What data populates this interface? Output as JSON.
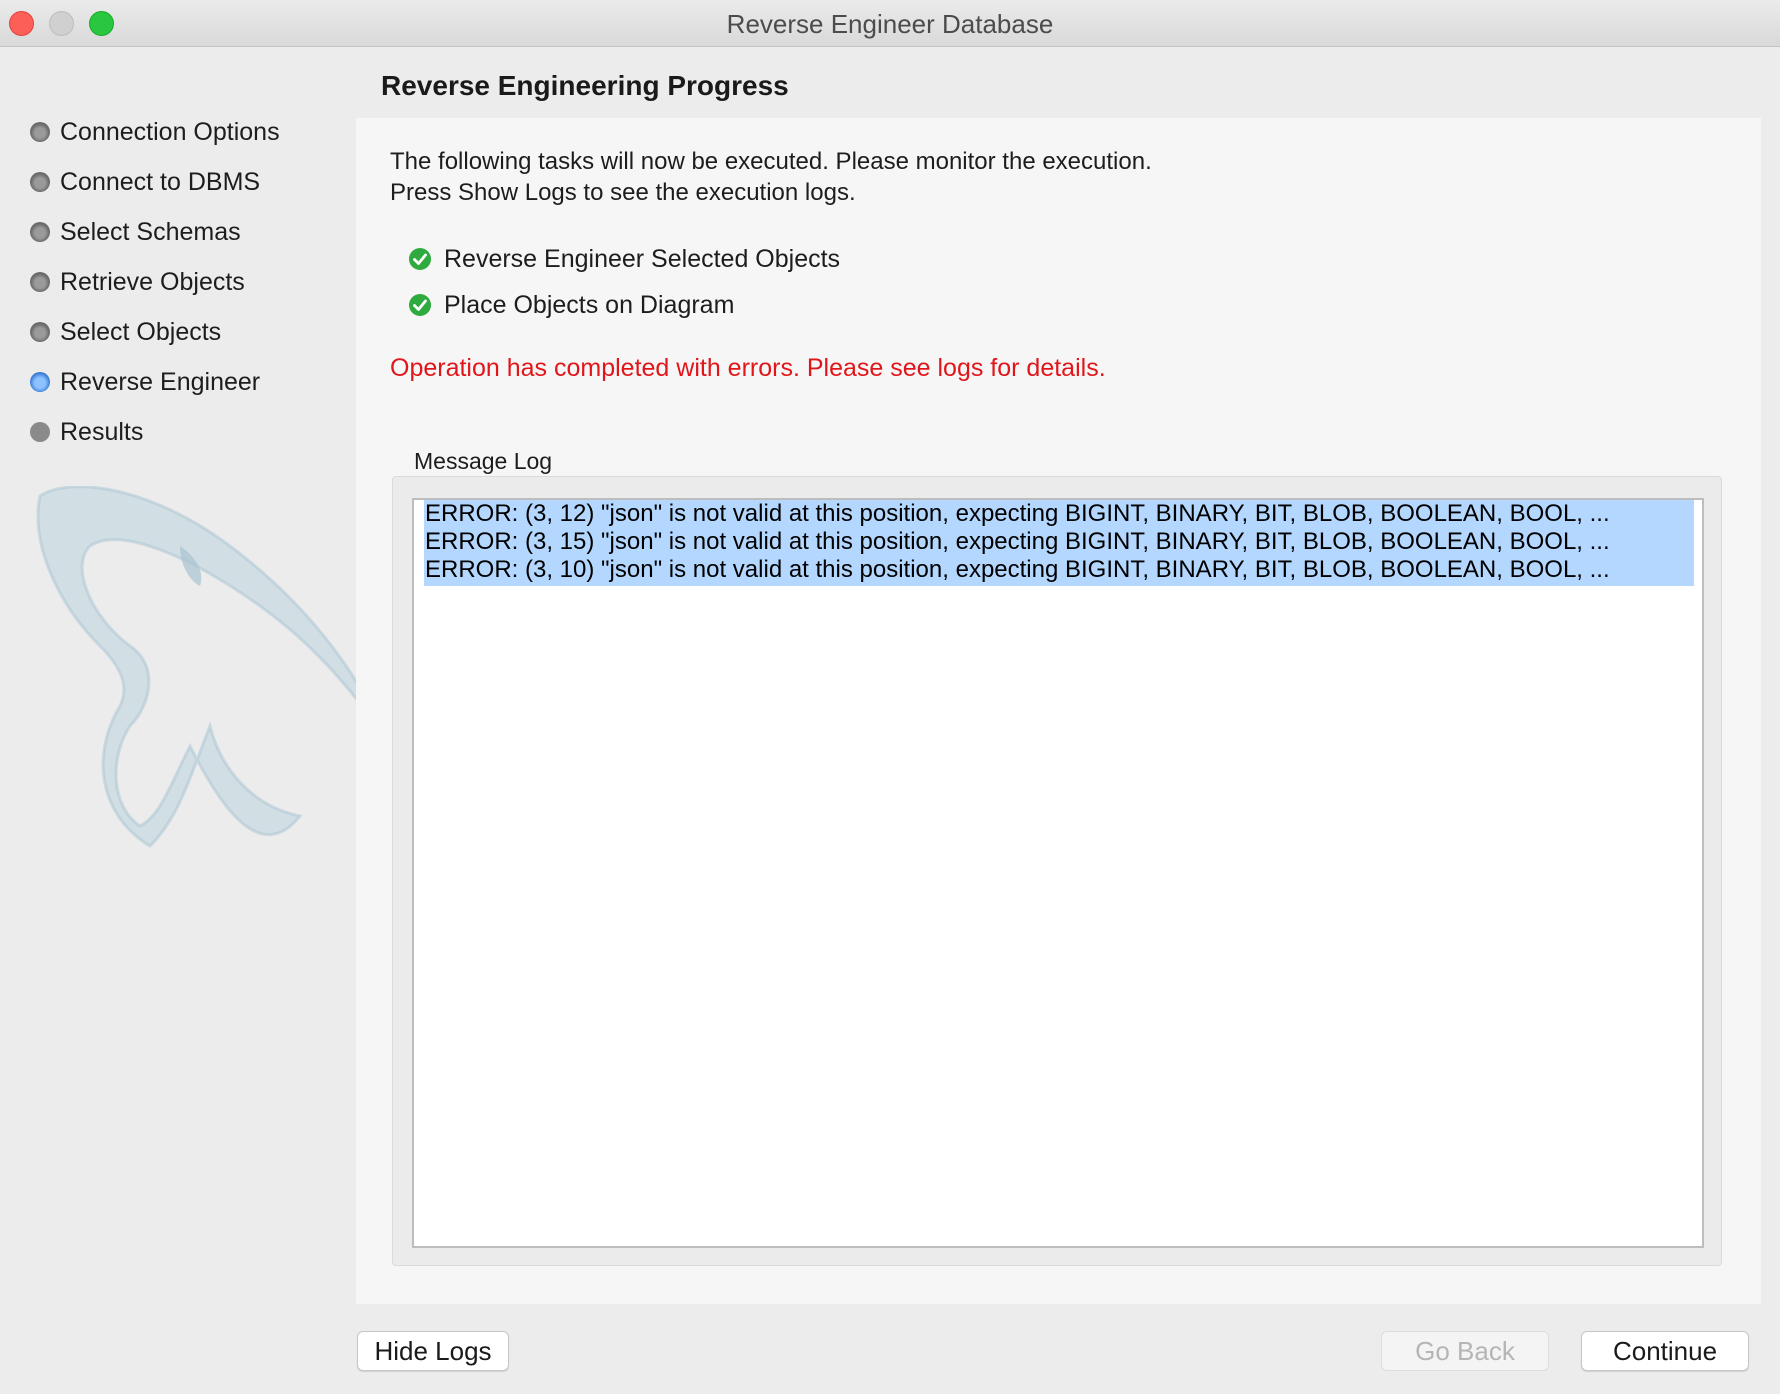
{
  "window": {
    "title": "Reverse Engineer Database"
  },
  "sidebar": {
    "steps": [
      {
        "label": "Connection Options",
        "state": "done"
      },
      {
        "label": "Connect to DBMS",
        "state": "done"
      },
      {
        "label": "Select Schemas",
        "state": "done"
      },
      {
        "label": "Retrieve Objects",
        "state": "done"
      },
      {
        "label": "Select Objects",
        "state": "done"
      },
      {
        "label": "Reverse Engineer",
        "state": "active"
      },
      {
        "label": "Results",
        "state": "pending"
      }
    ]
  },
  "main": {
    "heading": "Reverse Engineering Progress",
    "intro_line1": "The following tasks will now be executed. Please monitor the execution.",
    "intro_line2": "Press Show Logs to see the execution logs.",
    "tasks": [
      {
        "label": "Reverse Engineer Selected Objects",
        "status": "success"
      },
      {
        "label": "Place Objects on Diagram",
        "status": "success"
      }
    ],
    "status_message": "Operation has completed with errors. Please see logs for details.",
    "log_label": "Message Log",
    "log_lines": [
      "ERROR: (3, 12) \"json\" is not valid at this position, expecting BIGINT, BINARY, BIT, BLOB, BOOLEAN, BOOL, ...",
      "ERROR: (3, 15) \"json\" is not valid at this position, expecting BIGINT, BINARY, BIT, BLOB, BOOLEAN, BOOL, ...",
      "ERROR: (3, 10) \"json\" is not valid at this position, expecting BIGINT, BINARY, BIT, BLOB, BOOLEAN, BOOL, ..."
    ]
  },
  "buttons": {
    "hide_logs": "Hide Logs",
    "go_back": "Go Back",
    "continue": "Continue"
  },
  "colors": {
    "error_text": "#e0161a",
    "selection": "#b3d7ff",
    "check_green": "#2eaa3f",
    "active_step": "#3f7fd8"
  }
}
